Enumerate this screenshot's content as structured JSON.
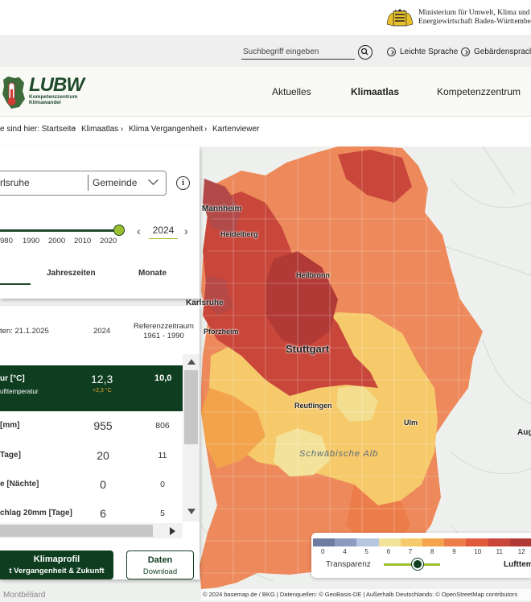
{
  "ministry": {
    "line1": "Ministerium für Umwelt, Klima und",
    "line2": "Energiewirtschaft Baden-Württember"
  },
  "utility": {
    "search_placeholder": "Suchbegriff eingeben",
    "easy_language": "Leichte Sprache",
    "sign_language": "Gebärdenspracl"
  },
  "logo": {
    "word": "LUBW",
    "sub1": "Kompetenzzentrum",
    "sub2": "Klimawandel"
  },
  "nav": {
    "items": [
      "Aktuelles",
      "Klimaatlas",
      "Kompetenzzentrum"
    ],
    "active": "Klimaatlas"
  },
  "breadcrumb": [
    "e sind hier: Startseite",
    "Klimaatlas",
    "Klima Vergangenheit",
    "Kartenviewer"
  ],
  "panel": {
    "region": "rlsruhe",
    "region_type": "Gemeinde",
    "info": "i",
    "year_ticks": [
      "980",
      "1990",
      "2000",
      "2010",
      "2020"
    ],
    "year": "2024",
    "prev": "‹",
    "next": "›",
    "tabs": [
      "Jahreszeiten",
      "Monate"
    ],
    "header": {
      "date": "ten: 21.1.2025",
      "year": "2024",
      "ref1": "Referenzzeitraum",
      "ref2": "1961 - 1990"
    },
    "highlight": {
      "label": "ur [°C]",
      "sub": "ufttemperatur",
      "value": "12,3",
      "delta": "+2,3 °C",
      "ref": "10,0"
    },
    "rows": [
      {
        "label": "[mm]",
        "value": "955",
        "ref": "806"
      },
      {
        "label": "Tage]",
        "value": "20",
        "ref": "11"
      },
      {
        "label": "e [Nächte]",
        "value": "0",
        "ref": "0"
      },
      {
        "label": "chlag 20mm [Tage]",
        "value": "6",
        "ref": "5"
      }
    ],
    "btn_klima": {
      "title": "Klimaprofil",
      "sub": "t Vergangenheit & Zukunft"
    },
    "btn_daten": {
      "title": "Daten",
      "sub": "Download"
    }
  },
  "map": {
    "cities": {
      "mannheim": "Mannheim",
      "heidelberg": "Heidelberg",
      "heilbronn": "Heilbronn",
      "karlsruhe": "Karlsruhe",
      "pforzheim": "Pforzheim",
      "stuttgart": "Stuttgart",
      "reutlingen": "Reutlingen",
      "ulm": "Ulm",
      "augsburg": "Aug",
      "alb": "Schwäbische Alb",
      "montbeliard": "Montbéliard"
    }
  },
  "legend": {
    "ticks": [
      "0",
      "4",
      "5",
      "6",
      "7",
      "8",
      "9",
      "10",
      "11",
      "12"
    ],
    "colors": [
      "#6f7da3",
      "#8c9bc0",
      "#b4c6e0",
      "#f1e49a",
      "#f6c96a",
      "#f2a34c",
      "#ec7d4a",
      "#e05a3c",
      "#c8463a",
      "#b23a36"
    ],
    "transparency_label": "Transparenz",
    "transparency": 0.6,
    "variable": "Lufttem"
  },
  "attribution": "© 2024 basemap.de / BKG | Datenquellen: © GeoBasis-DE | Außerhalb Deutschlands: © OpenStreetMap contributors"
}
